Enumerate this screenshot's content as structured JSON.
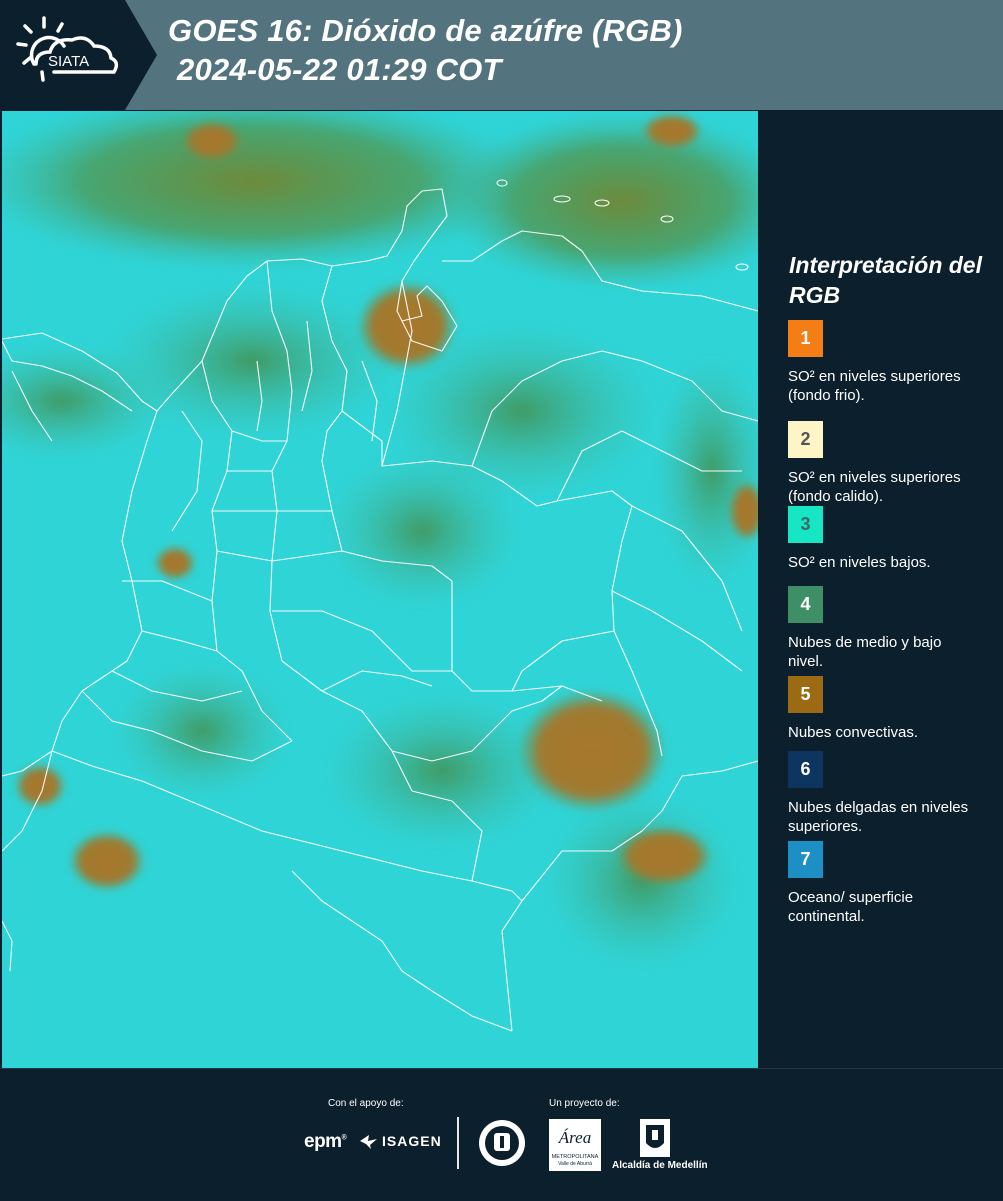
{
  "header": {
    "logo_text": "SIATA",
    "title_line1": "GOES 16: Dióxido de azúfre (RGB)",
    "title_line2": " 2024-05-22 01:29 COT"
  },
  "legend": {
    "title": "Interpretación del RGB",
    "items": [
      {
        "number": "1",
        "label": "SO² en niveles superiores (fondo frio).",
        "color": "#f47d15",
        "text_color": "#ffffff"
      },
      {
        "number": "2",
        "label": "SO² en niveles superiores (fondo calido).",
        "color": "#fdf5c5",
        "text_color": "#555555"
      },
      {
        "number": "3",
        "label": "SO² en niveles bajos.",
        "color": "#17e6c4",
        "text_color": "#3a6a66"
      },
      {
        "number": "4",
        "label": "Nubes de medio y bajo nivel.",
        "color": "#3f8f66",
        "text_color": "#ffffff"
      },
      {
        "number": "5",
        "label": "Nubes convectivas.",
        "color": "#9c6a12",
        "text_color": "#ffffff"
      },
      {
        "number": "6",
        "label": "Nubes delgadas en niveles superiores.",
        "color": "#0e3560",
        "text_color": "#ffffff"
      },
      {
        "number": "7",
        "label": "Oceano/ superficie continental.",
        "color": "#1e8fc5",
        "text_color": "#ffffff"
      }
    ]
  },
  "footer": {
    "support_caption": "Con el apoyo de:",
    "project_caption": "Un proyecto de:",
    "epm_logo": "epm",
    "isagen_logo": "ISAGEN",
    "area_logo_name": "Área",
    "area_logo_sub": "METROPOLITANA",
    "area_logo_sub2": "Valle de Aburrá",
    "alcaldia_label": "Alcaldía de Medellín"
  },
  "colors": {
    "background": "#0c1f2d",
    "header": "#53737f",
    "map_base": "#2fd6d8",
    "convective": "#a8772c",
    "mid_cloud": "#4f9a58",
    "borders": "#ffffff"
  }
}
